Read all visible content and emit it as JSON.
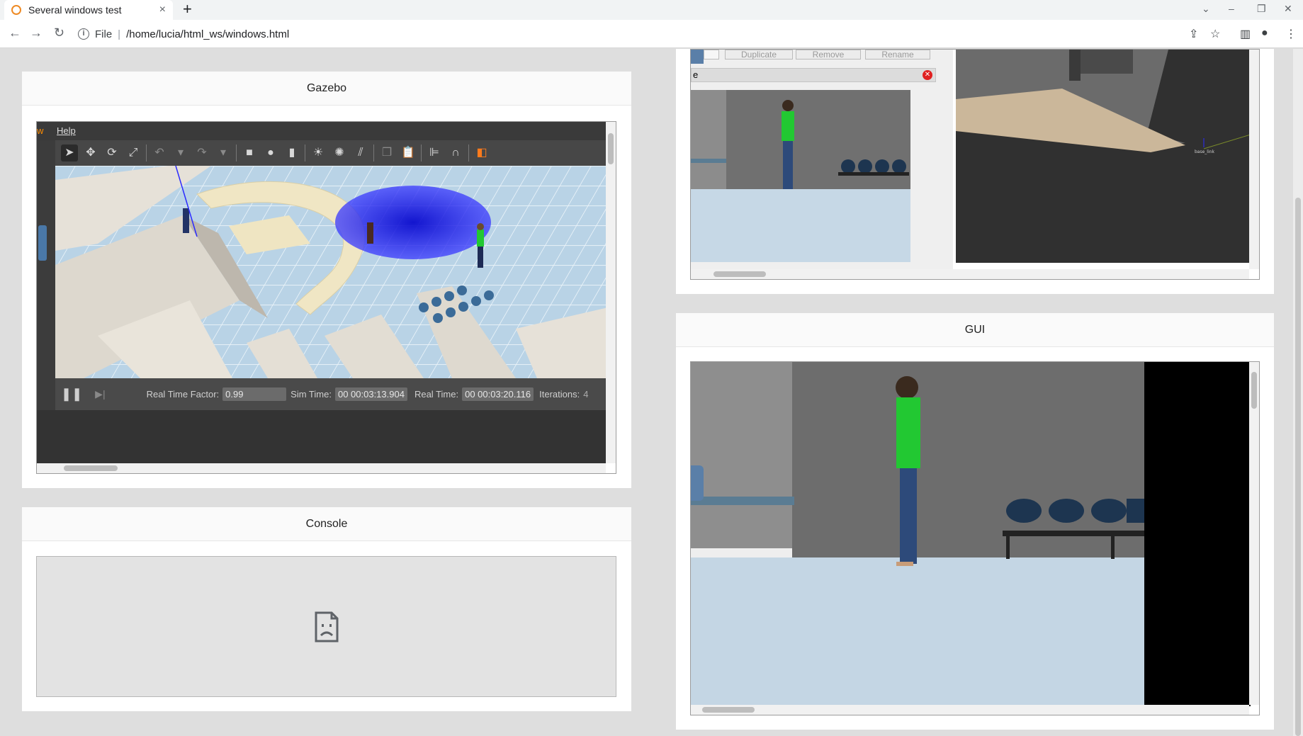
{
  "browser": {
    "tab_title": "Several windows test",
    "tab_close": "×",
    "new_tab": "+",
    "url_scheme_label": "File",
    "url_separator": "|",
    "url": "/home/lucia/html_ws/windows.html"
  },
  "panels": {
    "gazebo": {
      "title": "Gazebo",
      "menu_help": "Help",
      "menu_edge": "w",
      "status": {
        "rtf_label": "Real Time Factor:",
        "rtf_value": "0.99",
        "sim_time_label": "Sim Time:",
        "sim_time_value": "00 00:03:13.904",
        "real_time_label": "Real Time:",
        "real_time_value": "00 00:03:20.116",
        "iterations_label": "Iterations:",
        "iterations_value": "4"
      }
    },
    "console": {
      "title": "Console"
    },
    "rviz": {
      "buttons": [
        "Duplicate",
        "Remove",
        "Rename"
      ],
      "field_text": "e",
      "axis_label": "base_link"
    },
    "gui": {
      "title": "GUI"
    }
  },
  "colors": {
    "page_bg": "#dedede",
    "floor": "#d4e4ef",
    "wall": "#6e6e6e",
    "person_shirt": "#22c832",
    "laser": "#1a1aff"
  }
}
